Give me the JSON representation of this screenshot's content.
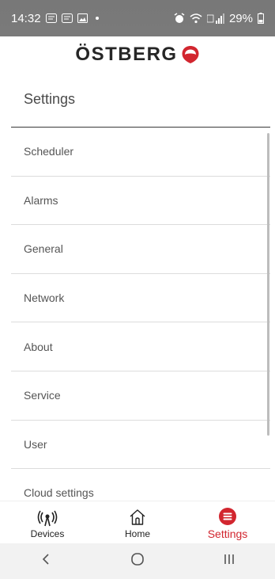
{
  "status_bar": {
    "time": "14:32",
    "battery": "29%"
  },
  "brand": {
    "name": "ÖSTBERG",
    "accent_color": "#d2262f"
  },
  "page": {
    "title": "Settings"
  },
  "settings_list": [
    {
      "label": "Scheduler"
    },
    {
      "label": "Alarms"
    },
    {
      "label": "General"
    },
    {
      "label": "Network"
    },
    {
      "label": "About"
    },
    {
      "label": "Service"
    },
    {
      "label": "User"
    },
    {
      "label": "Cloud settings"
    }
  ],
  "bottom_nav": {
    "items": [
      {
        "label": "Devices",
        "icon": "signal-tower-icon",
        "active": false
      },
      {
        "label": "Home",
        "icon": "home-icon",
        "active": false
      },
      {
        "label": "Settings",
        "icon": "menu-circle-icon",
        "active": true
      }
    ]
  },
  "system_nav": {
    "back": "back-icon",
    "home": "home-circle-icon",
    "recents": "recents-icon"
  }
}
